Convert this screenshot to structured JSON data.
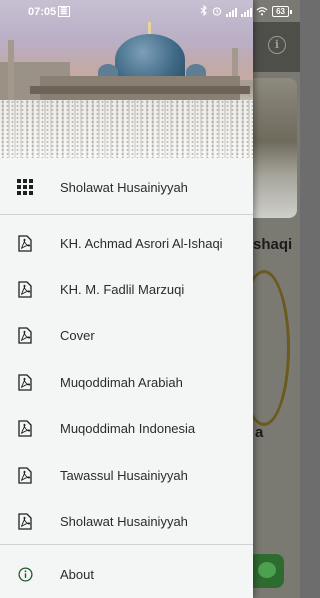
{
  "status_bar": {
    "time": "07:05",
    "notification_badge": "≣",
    "battery": "63",
    "icons": [
      "bluetooth-icon",
      "alarm-icon",
      "signal-icon",
      "signal-icon",
      "wifi-icon",
      "battery-icon"
    ]
  },
  "drawer": {
    "header_image": "mosque-crowd-photo",
    "items": [
      {
        "label": "Sholawat Husainiyyah",
        "icon": "grid-icon"
      },
      {
        "label": "KH. Achmad Asrori Al-Ishaqi",
        "icon": "pdf-icon"
      },
      {
        "label": "KH. M. Fadlil Marzuqi",
        "icon": "pdf-icon"
      },
      {
        "label": "Cover",
        "icon": "pdf-icon"
      },
      {
        "label": "Muqoddimah Arabiah",
        "icon": "pdf-icon"
      },
      {
        "label": "Muqoddimah Indonesia",
        "icon": "pdf-icon"
      },
      {
        "label": "Tawassul Husainiyyah",
        "icon": "pdf-icon"
      },
      {
        "label": "Sholawat Husainiyyah",
        "icon": "pdf-icon"
      },
      {
        "label": "About",
        "icon": "info-icon"
      }
    ]
  },
  "background_app": {
    "title_fragment": "shaqi",
    "letter_fragment": "a",
    "icons": [
      "info-icon"
    ]
  },
  "colors": {
    "drawer_bg": "#f4f6f5",
    "text": "#2b2b2b",
    "icon": "#1f1f1f",
    "dim_overlay": "#6d6d6d",
    "accent_green": "#2e6b2f"
  }
}
